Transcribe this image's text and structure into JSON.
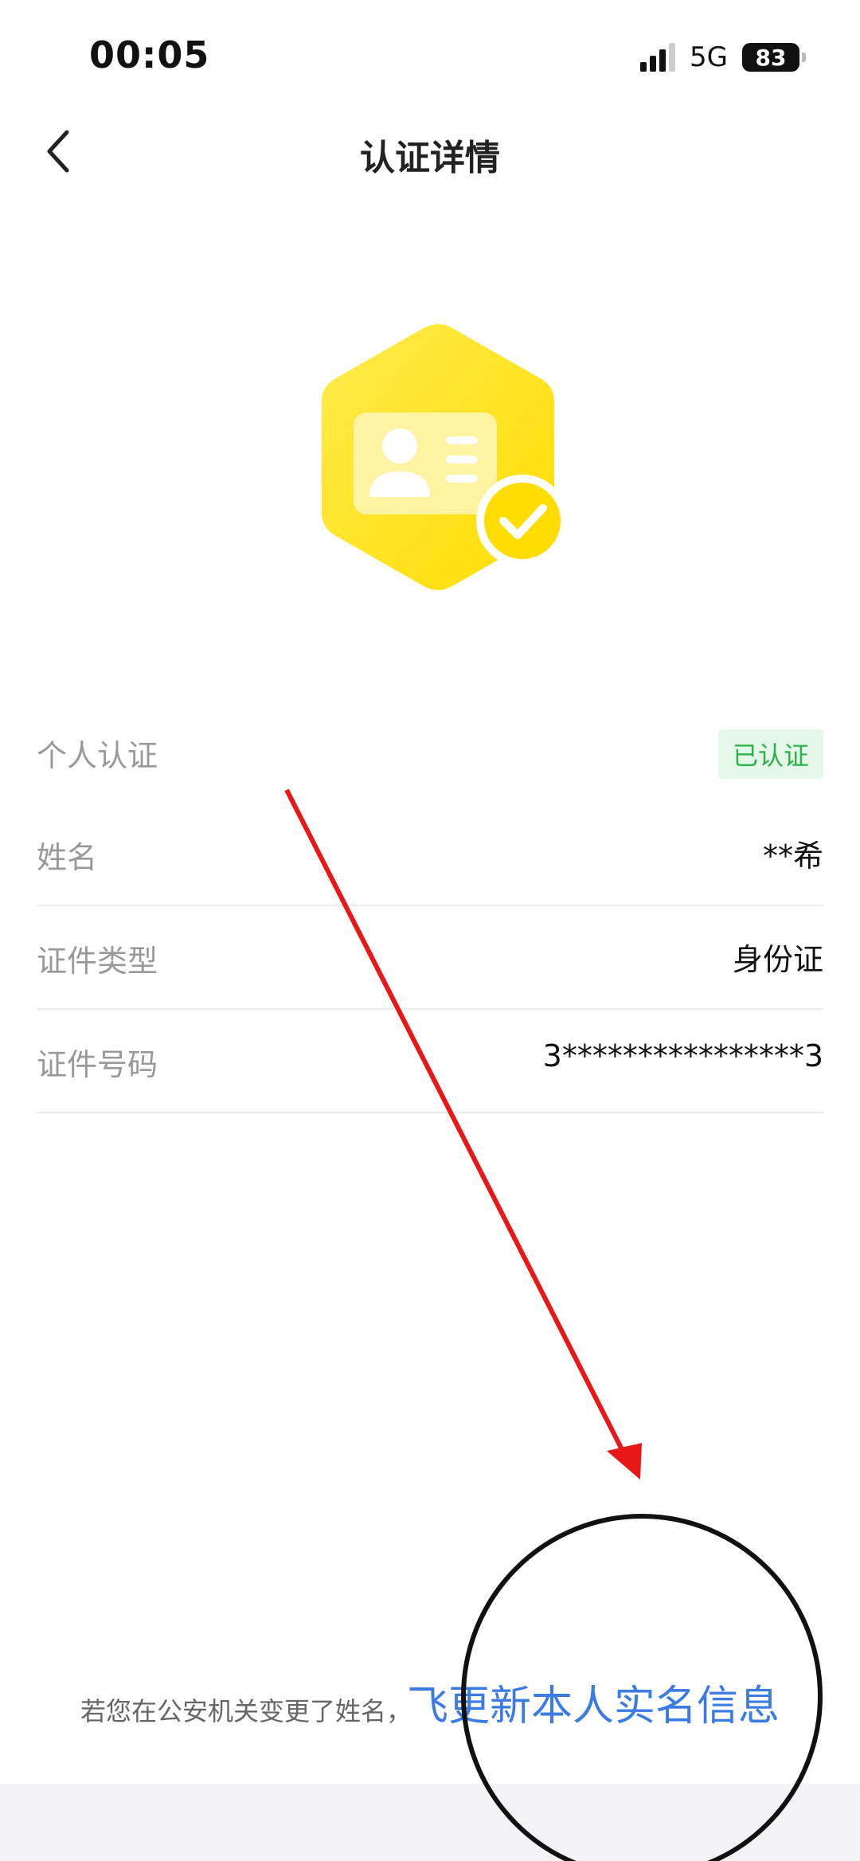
{
  "status_bar": {
    "time": "00:05",
    "network": "5G",
    "battery": "83"
  },
  "nav": {
    "title": "认证详情",
    "back_icon": "chevron-left-icon"
  },
  "badge": {
    "icon": "id-card-verified-icon",
    "colors": {
      "hex_start": "#FFE14A",
      "hex_end": "#FFE600",
      "check": "#FFD400"
    }
  },
  "info": {
    "rows": [
      {
        "label": "个人认证",
        "value": "已认证"
      },
      {
        "label": "姓名",
        "value": "**希"
      },
      {
        "label": "证件类型",
        "value": "身份证"
      },
      {
        "label": "证件号码",
        "value": "3****************3"
      }
    ]
  },
  "footer": {
    "note": "若您在公安机关变更了姓名，",
    "link_prefix": "飞",
    "link": "更新本人实名信息"
  },
  "colors": {
    "verified_text": "#29B34A",
    "verified_bg": "#E4F7E8",
    "link": "#3B7BE4",
    "annotation_arrow": "#E81818",
    "annotation_circle": "#111111"
  }
}
